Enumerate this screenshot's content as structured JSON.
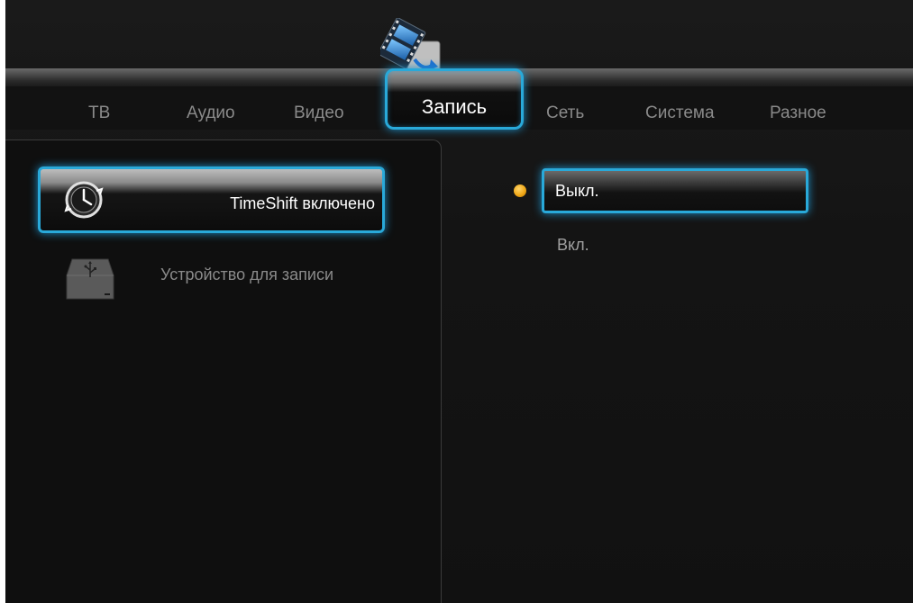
{
  "tabs": [
    {
      "label": "ТВ"
    },
    {
      "label": "Аудио"
    },
    {
      "label": "Видео"
    },
    {
      "label": "Запись",
      "active": true
    },
    {
      "label": "Сеть"
    },
    {
      "label": "Система"
    },
    {
      "label": "Разное"
    }
  ],
  "category_icon": "film-record-icon",
  "left_menu": {
    "items": [
      {
        "label": "TimeShift включено",
        "icon": "clock-icon",
        "selected": true
      },
      {
        "label": "Устройство для записи",
        "icon": "usb-drive-icon",
        "selected": false
      }
    ]
  },
  "options": {
    "items": [
      {
        "label": "Выкл.",
        "selected": true
      },
      {
        "label": "Вкл.",
        "selected": false
      }
    ]
  },
  "colors": {
    "highlight": "#29a9d9",
    "radio": "#f0a818",
    "background": "#121212"
  }
}
